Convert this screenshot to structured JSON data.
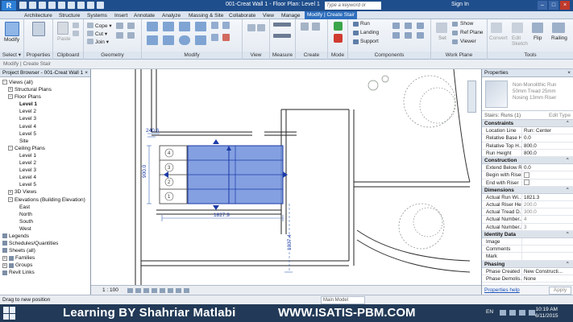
{
  "titlebar": {
    "title": "001-Creat Wall 1 - Floor Plan: Level 1",
    "search_placeholder": "Type a keyword or phrase",
    "signin": "Sign In"
  },
  "tabs": [
    "Architecture",
    "Structure",
    "Systems",
    "Insert",
    "Annotate",
    "Analyze",
    "Massing & Site",
    "Collaborate",
    "View",
    "Manage",
    "Modify | Create Stair"
  ],
  "ribbon": {
    "modify_label": "Modify",
    "select_label": "Select ▾",
    "properties_label": "Properties",
    "paste_label": "Paste",
    "clipboard_label": "Clipboard",
    "cope_label": "Cope ▾",
    "cut_label": "Cut ▾",
    "join_label": "Join ▾",
    "geometry_label": "Geometry",
    "modify_panel_label": "Modify",
    "view_label": "View",
    "measure_label": "Measure",
    "create_label": "Create",
    "mode_label": "Mode",
    "run_label": "Run",
    "landing_label": "Landing",
    "support_label": "Support",
    "components_label": "Components",
    "set_label": "Set",
    "show_label": "Show",
    "ref_plane_label": "Ref Plane",
    "viewer_label": "Viewer",
    "workplane_label": "Work Plane",
    "convert_label": "Convert",
    "edit_sketch_label": "Edit Sketch",
    "flip_label": "Flip",
    "railing_label": "Railing",
    "tools_label": "Tools"
  },
  "optionsbar": {
    "text": "Modify | Create Stair"
  },
  "browser": {
    "title": "Project Browser - 001-Creat Wall 1",
    "close": "×",
    "nodes": [
      {
        "label": "Views (all)",
        "indent": 0,
        "toggle": "−"
      },
      {
        "label": "Structural Plans",
        "indent": 1,
        "toggle": "+"
      },
      {
        "label": "Floor Plans",
        "indent": 1,
        "toggle": "−"
      },
      {
        "label": "Level 1",
        "indent": 3,
        "bold": true
      },
      {
        "label": "Level 2",
        "indent": 3
      },
      {
        "label": "Level 3",
        "indent": 3
      },
      {
        "label": "Level 4",
        "indent": 3
      },
      {
        "label": "Level 5",
        "indent": 3
      },
      {
        "label": "Site",
        "indent": 3
      },
      {
        "label": "Ceiling Plans",
        "indent": 1,
        "toggle": "−"
      },
      {
        "label": "Level 1",
        "indent": 3
      },
      {
        "label": "Level 2",
        "indent": 3
      },
      {
        "label": "Level 3",
        "indent": 3
      },
      {
        "label": "Level 4",
        "indent": 3
      },
      {
        "label": "Level 5",
        "indent": 3
      },
      {
        "label": "3D Views",
        "indent": 1,
        "toggle": "+"
      },
      {
        "label": "Elevations (Building Elevation)",
        "indent": 1,
        "toggle": "−"
      },
      {
        "label": "East",
        "indent": 3
      },
      {
        "label": "North",
        "indent": 3
      },
      {
        "label": "South",
        "indent": 3
      },
      {
        "label": "West",
        "indent": 3
      },
      {
        "label": "Legends",
        "indent": 0,
        "icon": true
      },
      {
        "label": "Schedules/Quantities",
        "indent": 0,
        "icon": true
      },
      {
        "label": "Sheets (all)",
        "indent": 0,
        "icon": true
      },
      {
        "label": "Families",
        "indent": 0,
        "toggle": "+",
        "icon": true
      },
      {
        "label": "Groups",
        "indent": 0,
        "toggle": "+",
        "icon": true
      },
      {
        "label": "Revit Links",
        "indent": 0,
        "icon": true
      }
    ]
  },
  "canvas": {
    "dim_top": "240.6",
    "dim_vertical": "900.0",
    "dim_width": "1827.9",
    "dim_right": "1037.4",
    "tread_labels": [
      "4",
      "3",
      "2",
      "1"
    ]
  },
  "viewbar": {
    "scale": "1 : 100"
  },
  "properties": {
    "title": "Properties",
    "close": "×",
    "type_name": "Non-Monolithic Run\n50mm Tread 25mm\nNosing 13mm Riser",
    "instance": "Stairs: Runs (1)",
    "edit_type": "Edit Type",
    "groups": [
      {
        "name": "Constraints",
        "rows": [
          {
            "k": "Location Line",
            "v": "Run: Center"
          },
          {
            "k": "Relative Base H...",
            "v": "0.0"
          },
          {
            "k": "Relative Top H...",
            "v": "800.0"
          },
          {
            "k": "Run Height",
            "v": "800.0"
          }
        ]
      },
      {
        "name": "Construction",
        "rows": [
          {
            "k": "Extend Below R...",
            "v": "0.0"
          },
          {
            "k": "Begin with Riser",
            "v": "",
            "cb": true
          },
          {
            "k": "End with Riser",
            "v": "",
            "cb": true
          }
        ]
      },
      {
        "name": "Dimensions",
        "rows": [
          {
            "k": "Actual Run Wi...",
            "v": "1821.3"
          },
          {
            "k": "Actual Riser He...",
            "v": "200.0",
            "ro": true
          },
          {
            "k": "Actual Tread D...",
            "v": "300.0",
            "ro": true
          },
          {
            "k": "Actual Number...",
            "v": "4",
            "ro": true
          },
          {
            "k": "Actual Number...",
            "v": "3",
            "ro": true
          }
        ]
      },
      {
        "name": "Identity Data",
        "rows": [
          {
            "k": "Image",
            "v": ""
          },
          {
            "k": "Comments",
            "v": ""
          },
          {
            "k": "Mark",
            "v": ""
          }
        ]
      },
      {
        "name": "Phasing",
        "rows": [
          {
            "k": "Phase Created",
            "v": "New Constructi..."
          },
          {
            "k": "Phase Demolis...",
            "v": "None"
          }
        ]
      }
    ],
    "help_link": "Properties help",
    "apply": "Apply"
  },
  "statusbar": {
    "message": "Drag to new position",
    "model": "Main Model"
  },
  "taskbar": {
    "banner_left": "Learning BY Shahriar Matlabi",
    "banner_right": "WWW.ISATIS-PBM.COM",
    "lang": "EN",
    "time": "10:19 AM",
    "date": "6/11/2015"
  }
}
